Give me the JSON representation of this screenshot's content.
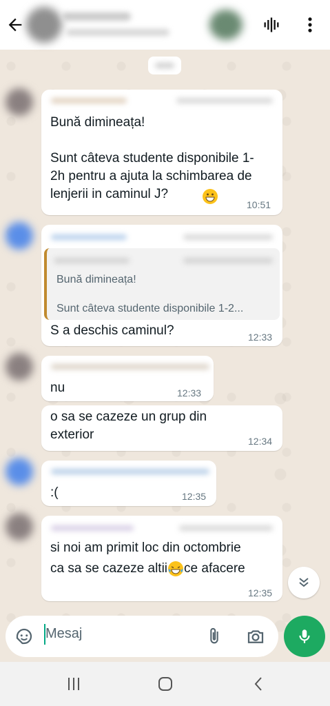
{
  "input": {
    "placeholder": "Mesaj"
  },
  "messages": [
    {
      "text": "Bună dimineața!\n\nSunt câteva studente disponibile 1-2h pentru a ajuta la schimbarea de lenjerii in caminul J?",
      "time": "10:51"
    },
    {
      "quote_line1": "Bună dimineața!",
      "quote_line2": "Sunt câteva studente disponibile 1-2...",
      "text": "S a deschis caminul?",
      "time": "12:33"
    },
    {
      "text": "nu",
      "time": "12:33"
    },
    {
      "text": "o sa se cazeze un grup din\nexterior",
      "time": "12:34"
    },
    {
      "text": ":(",
      "time": "12:35"
    },
    {
      "text_a": "si noi am primit loc din octombrie",
      "text_b1": "ca sa se cazeze altii",
      "text_b2": "ce afacere",
      "time": "12:35"
    }
  ],
  "icons": {
    "back": "arrow-left-icon",
    "voice_call": "audio-wave-icon",
    "menu": "more-vert-icon",
    "sticker": "sticker-icon",
    "attach": "paperclip-icon",
    "camera": "camera-icon",
    "mic": "microphone-icon",
    "scroll_down": "double-chevron-down-icon",
    "emoji_grin": "grinning-emoji",
    "emoji_tears": "tears-of-joy-emoji"
  },
  "colors": {
    "accent": "#1daa61",
    "quote_bar": "#c08a2f",
    "wallpaper": "#efe7dd"
  }
}
